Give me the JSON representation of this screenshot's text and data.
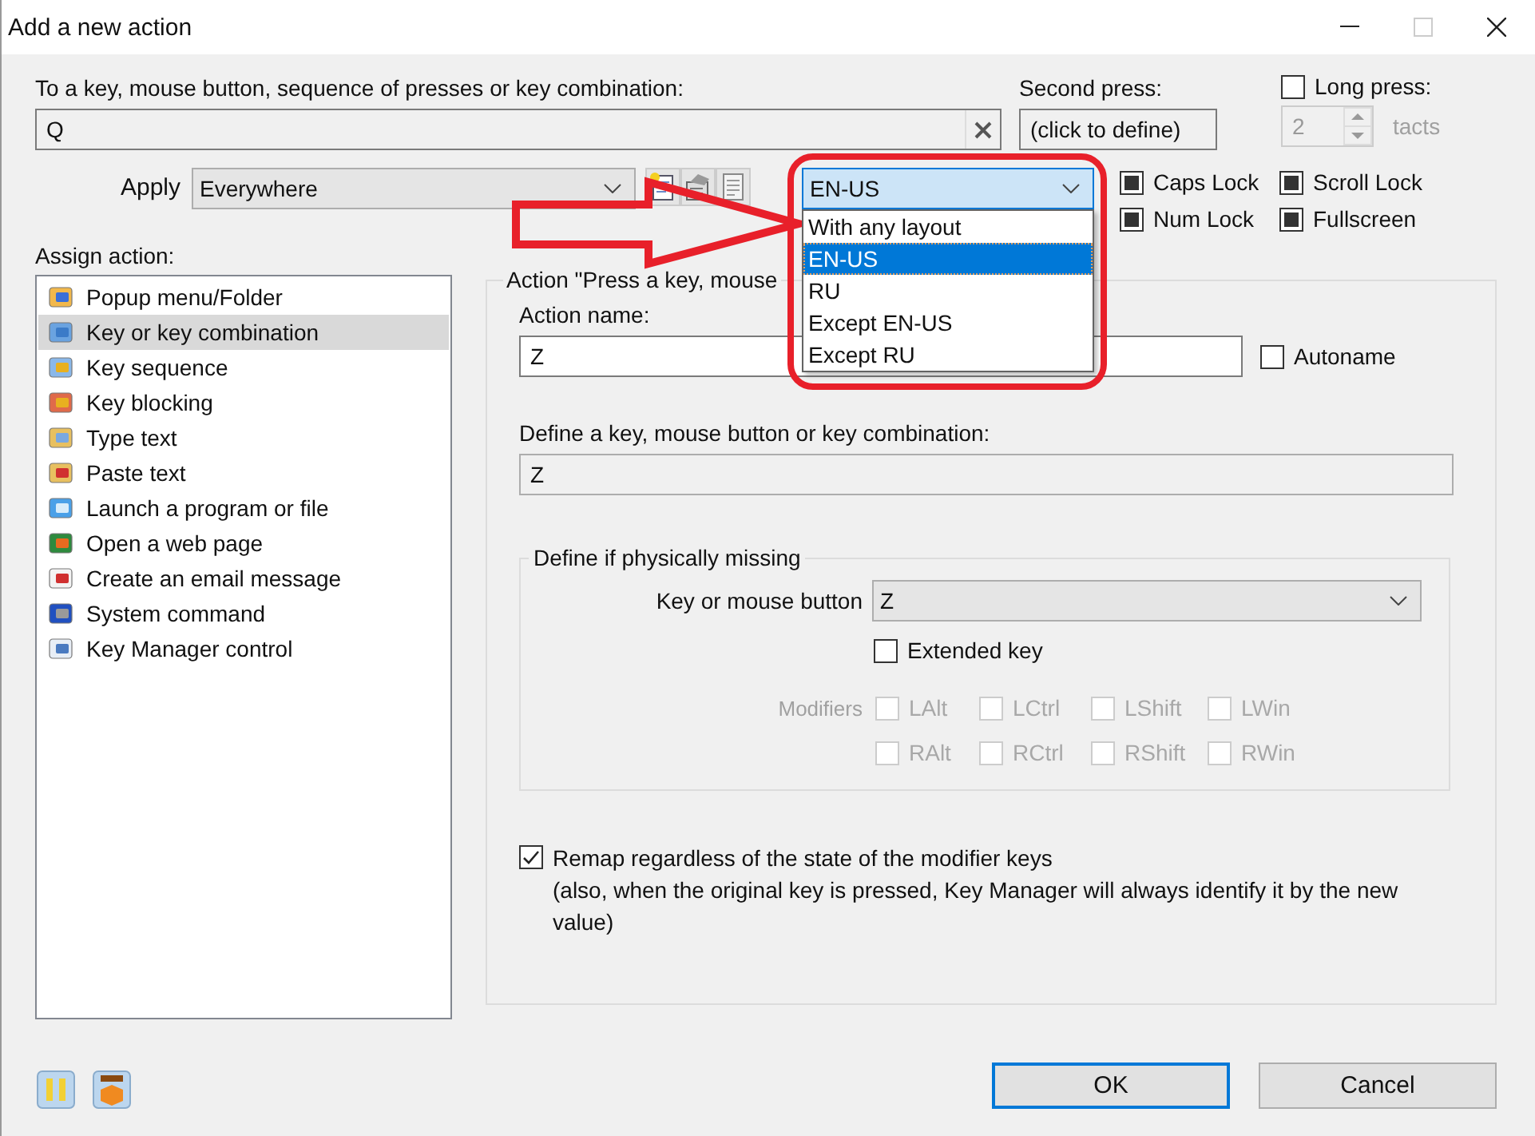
{
  "window": {
    "title": "Add a new action"
  },
  "target": {
    "label": "To a key, mouse button, sequence of presses or key combination:",
    "value": "Q"
  },
  "second_press": {
    "label": "Second press:",
    "value": "(click to define)"
  },
  "long_press": {
    "label": "Long press:",
    "checked": false,
    "value": "2",
    "unit": "tacts",
    "disabled": true
  },
  "apply": {
    "label": "Apply",
    "value": "Everywhere"
  },
  "layout": {
    "value": "EN-US",
    "expanded": true,
    "options": [
      {
        "label": "With any layout",
        "selected": false
      },
      {
        "label": "EN-US",
        "selected": true
      },
      {
        "label": "RU",
        "selected": false
      },
      {
        "label": "Except EN-US",
        "selected": false
      },
      {
        "label": "Except RU",
        "selected": false
      }
    ]
  },
  "toggles": [
    {
      "label": "Caps Lock",
      "indeterminate": true
    },
    {
      "label": "Scroll Lock",
      "indeterminate": true
    },
    {
      "label": "Num Lock",
      "indeterminate": true
    },
    {
      "label": "Fullscreen",
      "indeterminate": true
    }
  ],
  "assign": {
    "label": "Assign action:",
    "items": [
      {
        "label": "Popup menu/Folder",
        "selected": false
      },
      {
        "label": "Key or key combination",
        "selected": true
      },
      {
        "label": "Key sequence",
        "selected": false
      },
      {
        "label": "Key blocking",
        "selected": false
      },
      {
        "label": "Type text",
        "selected": false
      },
      {
        "label": "Paste text",
        "selected": false
      },
      {
        "label": "Launch a program or file",
        "selected": false
      },
      {
        "label": "Open a web page",
        "selected": false
      },
      {
        "label": "Create an email message",
        "selected": false
      },
      {
        "label": "System command",
        "selected": false
      },
      {
        "label": "Key Manager control",
        "selected": false
      }
    ]
  },
  "action": {
    "legend": "Action \"Press a key, mouse",
    "name_label": "Action name:",
    "name": "Z",
    "autoname": {
      "label": "Autoname",
      "checked": false
    },
    "define_label": "Define a key, mouse button or key combination:",
    "define_value": "Z",
    "missing": {
      "legend": "Define if physically missing",
      "key_label": "Key or mouse button",
      "key_value": "Z",
      "extended": {
        "label": "Extended key",
        "checked": false
      },
      "modifiers_label": "Modifiers",
      "modifiers": [
        {
          "label": "LAlt",
          "checked": false,
          "disabled": true
        },
        {
          "label": "LCtrl",
          "checked": false,
          "disabled": true
        },
        {
          "label": "LShift",
          "checked": false,
          "disabled": true
        },
        {
          "label": "LWin",
          "checked": false,
          "disabled": true
        },
        {
          "label": "RAlt",
          "checked": false,
          "disabled": true
        },
        {
          "label": "RCtrl",
          "checked": false,
          "disabled": true
        },
        {
          "label": "RShift",
          "checked": false,
          "disabled": true
        },
        {
          "label": "RWin",
          "checked": false,
          "disabled": true
        }
      ]
    },
    "remap": {
      "label": "Remap regardless of the state of the modifier keys",
      "note": "(also, when the original key is pressed, Key Manager will always identify it by the new value)",
      "checked": true
    }
  },
  "buttons": [
    {
      "label": "OK",
      "default": true
    },
    {
      "label": "Cancel",
      "default": false
    }
  ]
}
